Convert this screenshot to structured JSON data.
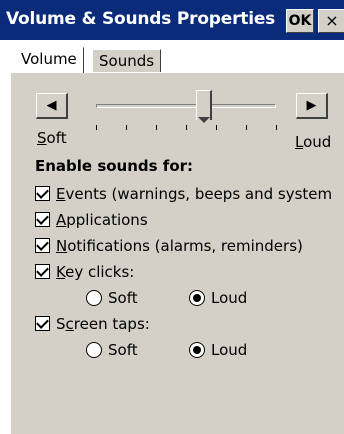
{
  "window": {
    "title": "Volume & Sounds Properties",
    "ok_label": "OK",
    "close_label": "×"
  },
  "tabs": [
    {
      "label": "Volume",
      "selected": true
    },
    {
      "label": "Sounds",
      "selected": false
    }
  ],
  "volume": {
    "soft_prefix": "S",
    "soft_rest": "oft",
    "loud_prefix": "L",
    "loud_rest": "oud",
    "level": 0.6,
    "tick_count": 7,
    "down_arrow": "◀",
    "up_arrow": "▶"
  },
  "enable_heading": "Enable sounds for:",
  "options": [
    {
      "prefix": "",
      "key": "E",
      "rest": "vents (warnings, beeps and system",
      "checked": true
    },
    {
      "prefix": "",
      "key": "A",
      "rest": "pplications",
      "checked": true
    },
    {
      "prefix": "",
      "key": "N",
      "rest": "otifications (alarms, reminders)",
      "checked": true
    },
    {
      "prefix": "",
      "key": "K",
      "rest": "ey clicks:",
      "checked": true
    },
    {
      "prefix": "S",
      "key": "c",
      "rest": "reen taps:",
      "checked": true
    }
  ],
  "key_clicks_radios": [
    {
      "label": "Soft",
      "selected": false
    },
    {
      "label": "Loud",
      "selected": true
    }
  ],
  "screen_taps_radios": [
    {
      "label": "Soft",
      "selected": false
    },
    {
      "label": "Loud",
      "selected": true
    }
  ],
  "colors": {
    "titlebar": "#0a2a7a",
    "panel": "#d4d0c8"
  }
}
